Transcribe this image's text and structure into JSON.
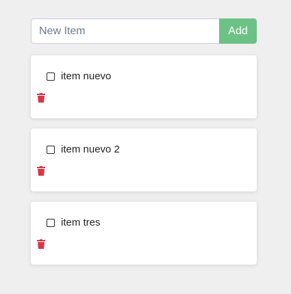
{
  "form": {
    "placeholder": "New Item",
    "value": "",
    "add_label": "Add"
  },
  "colors": {
    "add": "#6cc285",
    "trash": "#dc3545"
  },
  "items": [
    {
      "label": "item nuevo",
      "checked": false
    },
    {
      "label": "item nuevo 2",
      "checked": false
    },
    {
      "label": "item tres",
      "checked": false
    }
  ]
}
